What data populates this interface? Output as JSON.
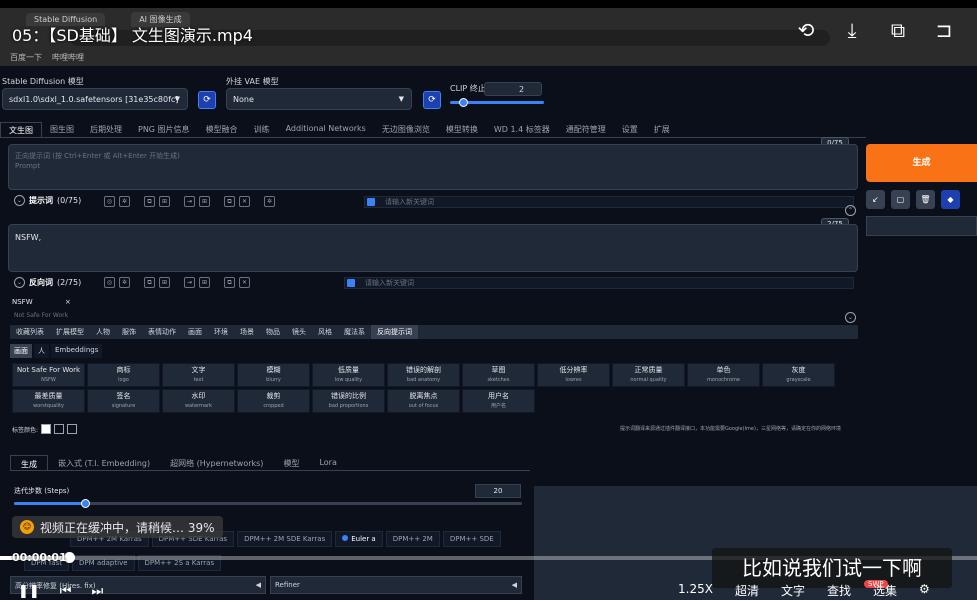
{
  "browser": {
    "tab1": "Stable Diffusion",
    "tab2": "AI 图像生成",
    "bookmark1": "百度一下",
    "bookmark2": "哔哩哔哩"
  },
  "video": {
    "title": "05：【SD基础】 文生图演示.mp4",
    "buffer_text": "视频正在缓冲中，请稍候… 39%",
    "time": "00:00:01",
    "progress_fraction": 0.07,
    "subtitle": "比如说我们试一下啊",
    "speed": "1.25X",
    "quality": "超清",
    "text_btn": "文字",
    "find_btn": "查找",
    "select_btn": "选集",
    "swp": "SWP"
  },
  "sd": {
    "model_label": "Stable Diffusion 模型",
    "model_value": "sdxl1.0\\sdxl_1.0.safetensors [31e35c80fc]",
    "vae_label": "外挂 VAE 模型",
    "vae_value": "None",
    "clip_label": "CLIP 终止层数",
    "clip_value": "2",
    "clip_fraction": 0.1
  },
  "main_tabs": [
    "文生图",
    "图生图",
    "后期处理",
    "PNG 图片信息",
    "模型融合",
    "训练",
    "Additional Networks",
    "无边图像浏览",
    "模型转换",
    "WD 1.4 标签器",
    "通配符管理",
    "设置",
    "扩展"
  ],
  "prompt": {
    "placeholder_line1": "正向提示词 (按 Ctrl+Enter 或 Alt+Enter 开始生成)",
    "placeholder_line2": "Prompt",
    "counter": "0/75",
    "label": "提示词",
    "label_count": "(0/75)",
    "keyword_placeholder": "请输入新关键词"
  },
  "generate": {
    "label": "生成"
  },
  "negative": {
    "value": "NSFW,",
    "counter": "2/75",
    "label": "反向词",
    "label_count": "(2/75)",
    "keyword_placeholder": "请输入新关键词"
  },
  "tag": {
    "name": "NSFW",
    "close": "×",
    "sub": "Not Safe For Work"
  },
  "category_tabs": [
    "收藏列表",
    "扩展模型",
    "人物",
    "服饰",
    "表情动作",
    "画面",
    "环境",
    "场景",
    "物品",
    "镜头",
    "风格",
    "魔法系",
    "反向提示词"
  ],
  "sub_tabs": [
    "画面",
    "人",
    "Embeddings"
  ],
  "tags": [
    {
      "zh": "Not Safe For Work",
      "en": "NSFW"
    },
    {
      "zh": "商标",
      "en": "logo"
    },
    {
      "zh": "文字",
      "en": "text"
    },
    {
      "zh": "模糊",
      "en": "blurry"
    },
    {
      "zh": "低质量",
      "en": "low quality"
    },
    {
      "zh": "错误的解剖",
      "en": "bad anatomy"
    },
    {
      "zh": "草图",
      "en": "sketches"
    },
    {
      "zh": "低分辨率",
      "en": "lowres"
    },
    {
      "zh": "正常质量",
      "en": "normal quality"
    },
    {
      "zh": "单色",
      "en": "monochrome"
    },
    {
      "zh": "灰度",
      "en": "grayscale"
    },
    {
      "zh": "最差质量",
      "en": "worstquality"
    },
    {
      "zh": "签名",
      "en": "signature"
    },
    {
      "zh": "水印",
      "en": "watermark"
    },
    {
      "zh": "裁剪",
      "en": "cropped"
    },
    {
      "zh": "错误的比例",
      "en": "bad proportions"
    },
    {
      "zh": "脱离焦点",
      "en": "out of focus"
    },
    {
      "zh": "用户名",
      "en": "用户名"
    }
  ],
  "color_label": "标签颜色:",
  "tip_text": "提示词翻译来源通过插件翻译接口，本功能需要Google(Ime)，三星网络等，请确定在你的网络环境",
  "gen_tabs": [
    "生成",
    "嵌入式 (T.I. Embedding)",
    "超网络 (Hypernetworks)",
    "模型",
    "Lora"
  ],
  "steps": {
    "label": "迭代步数 (Steps)",
    "value": "20",
    "fraction": 0.14
  },
  "samplers_row1": [
    "DPM++ 2M Karras",
    "DPM++ SDE Karras",
    "DPM++ 2M SDE Karras",
    "Euler a",
    "DPM++ 2M",
    "DPM++ SDE"
  ],
  "samplers_row2": [
    "DPM fast",
    "DPM adaptive",
    "DPM++ 2S a Karras"
  ],
  "hires_label": "高分辨率修复 (Hires. fix)",
  "refiner_label": "Refiner",
  "colors": {
    "accent": "#3b82f6",
    "generate": "#f97316",
    "bg": "#0b0f19"
  }
}
